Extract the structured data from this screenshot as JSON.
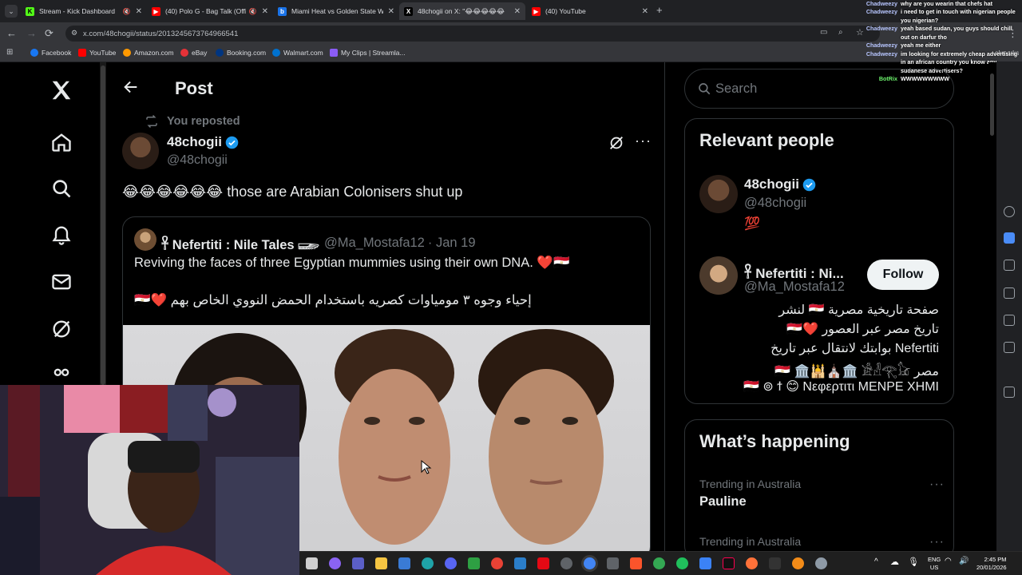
{
  "browser": {
    "tabs": [
      {
        "title": "Stream - Kick Dashboard",
        "favicon": "K",
        "color": "#53fc18",
        "active": false
      },
      {
        "title": "(40) Polo G - Bag Talk (Offic",
        "favicon": "▶",
        "color": "#ff0000",
        "active": false
      },
      {
        "title": "Miami Heat vs Golden State Wa",
        "favicon": "b",
        "color": "#1a73e8",
        "active": false
      },
      {
        "title": "48chogii on X: \"😂😂😂😂😂",
        "favicon": "X",
        "color": "#000000",
        "active": true
      },
      {
        "title": "(40) YouTube",
        "favicon": "▶",
        "color": "#ff0000",
        "active": false
      }
    ],
    "url": "x.com/48chogii/status/2013245673764966541",
    "bookmarks": [
      {
        "label": "Facebook",
        "color": "#1877f2"
      },
      {
        "label": "YouTube",
        "color": "#ff0000"
      },
      {
        "label": "Amazon.com",
        "color": "#ff9900"
      },
      {
        "label": "eBay",
        "color": "#e53238"
      },
      {
        "label": "Booking.com",
        "color": "#003580"
      },
      {
        "label": "Walmart.com",
        "color": "#0071ce"
      },
      {
        "label": "My Clips | Streamla...",
        "color": "#8b5cf6"
      }
    ],
    "all_bookmarks_fragment": "okmarks"
  },
  "chat": [
    {
      "user": "Chadweezy",
      "msg": "why are you wearin that chefs hat"
    },
    {
      "user": "Chadweezy",
      "msg": "i need to get in touch with nigerian people you nigerian?"
    },
    {
      "user": "Chadweezy",
      "msg": "yeah based sudan, you guys should chill out on darfur tho"
    },
    {
      "user": "Chadweezy",
      "msg": "yeah me either"
    },
    {
      "user": "Chadweezy",
      "msg": "im looking for extremely cheap advertising in an african country you know any sudanese advertisers?"
    },
    {
      "user": "BotRix",
      "msg": "WWWWWWWWW"
    }
  ],
  "page": {
    "title": "Post",
    "repost_label": "You reposted",
    "author_name": "48chogii",
    "author_handle": "@48chogii",
    "tweet_emojis": "😂😂😂😂😂😂",
    "tweet_text": "those are Arabian Colonisers shut up",
    "quote": {
      "name": "𓋹 Nefertiti : Nile Tales 𓆃",
      "handle": "@Ma_Mostafa12",
      "date": "· Jan 19",
      "text_en": "Reviving the faces of three Egyptian mummies using their own DNA. ❤️🇪🇬",
      "text_ar": "إحياء وجوه ٣ مومياوات كصريه باستخدام الحمض النووي الخاص بهم ❤️🇪🇬"
    }
  },
  "sidebar": {
    "search_placeholder": "Search",
    "relevant_title": "Relevant people",
    "people": [
      {
        "name": "48chogii",
        "handle": "@48chogii",
        "bio": "💯"
      },
      {
        "name": "𓋹 Nefertiti : Ni...",
        "handle": "@Ma_Mostafa12",
        "follow_label": "Follow",
        "bio_lines": [
          "صفحة تاريخية مصرية 🇪🇬 لنشر",
          "تاريخ مصر عبر العصور ❤️🇪🇬",
          "Nefertiti بوابتك لانتقال عبر تاريخ",
          "مصر 🇪🇬 🏛️🕌⛪🏛️ 𓀀𓁐𓂀𓃠",
          "🇪🇬 ⊚ ϯ 😊 Νεφερτιτι ΜΕΝΡΕ ΧΗΜΙ"
        ]
      }
    ],
    "happening_title": "What’s happening",
    "trends": [
      {
        "meta": "Trending in Australia",
        "name": "Pauline"
      },
      {
        "meta": "Trending in Australia",
        "name": ""
      }
    ]
  },
  "taskbar": {
    "lang_top": "ENG",
    "lang_bottom": "US",
    "time": "2:45 PM",
    "date": "20/01/2026"
  }
}
